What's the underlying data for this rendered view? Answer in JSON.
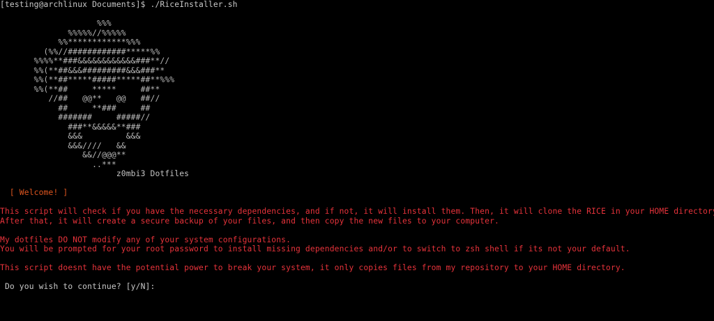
{
  "terminal": {
    "command_line": "[testing@archlinux Documents]$ ./RiceInstaller.sh",
    "ascii_art": [
      "                    %%%",
      "              %%%%%//%%%%%",
      "            %%************%%%",
      "         (%%//############*****%%",
      "       %%%%**###&&&&&&&&&&&&###**//",
      "       %%(**##&&&#########&&&###**",
      "       %%(**##*****#####*****##**%%%",
      "       %%(**##     *****     ##**",
      "          //##   @@**   @@   ##//",
      "            ##     **###     ##",
      "            #######     #####//",
      "              ###**&&&&&**###",
      "              &&&         &&&",
      "              &&&////   &&",
      "                 &&//@@@**",
      "                   ..***"
    ],
    "dotfiles_label": "                        z0mbi3 Dotfiles",
    "welcome_line": "  [ Welcome! ]",
    "info_paragraphs": [
      "This script will check if you have the necessary dependencies, and if not, it will install them. Then, it will clone the RICE in your HOME directory.",
      "After that, it will create a secure backup of your files, and then copy the new files to your computer.",
      "My dotfiles DO NOT modify any of your system configurations.",
      "You will be prompted for your root password to install missing dependencies and/or to switch to zsh shell if its not your default.",
      "This script doesnt have the potential power to break your system, it only copies files from my repository to your HOME directory."
    ],
    "prompt_question": " Do you wish to continue? [y/N]:"
  },
  "colors": {
    "background": "#000000",
    "prompt_text": "#c8c8c8",
    "ascii_art": "#b8b8b8",
    "welcome": "#e0561f",
    "message": "#e8333b"
  }
}
